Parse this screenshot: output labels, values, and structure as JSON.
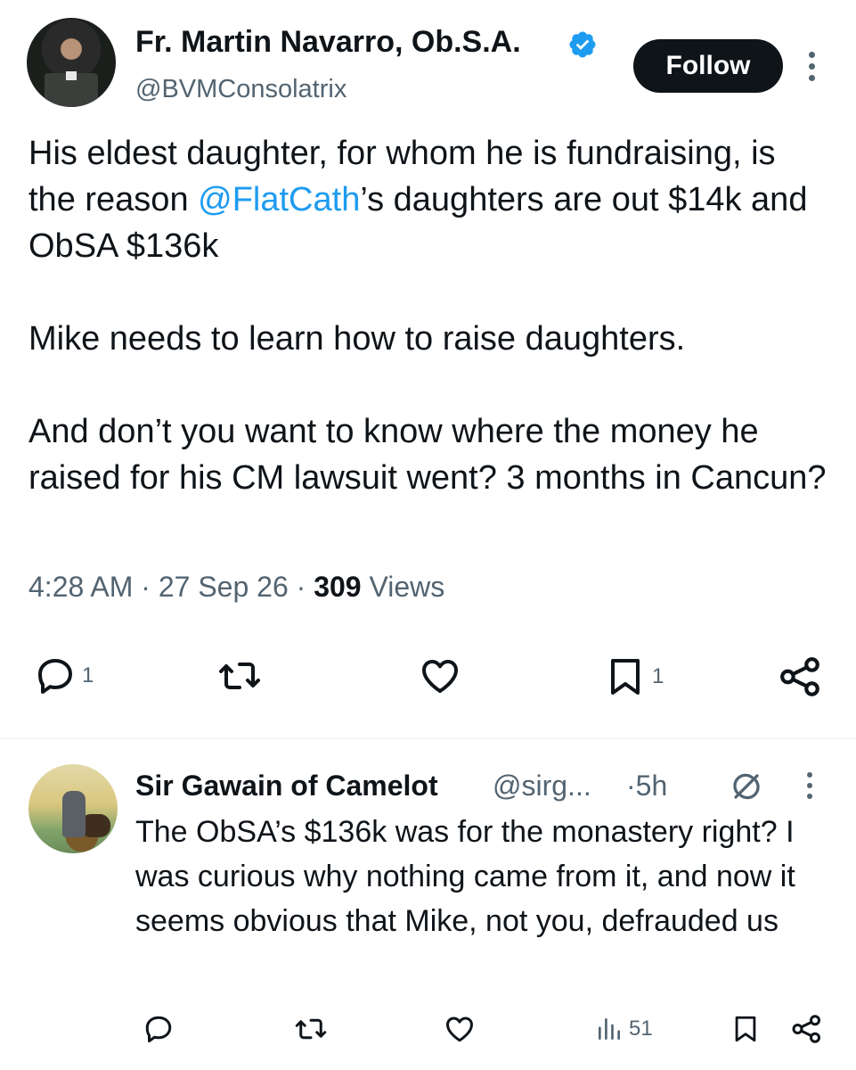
{
  "main_tweet": {
    "author_name": "Fr. Martin Navarro, Ob.S.A.",
    "handle": "@BVMConsolatrix",
    "follow_label": "Follow",
    "text_para1_before": "His eldest daughter, for whom he is fundraising, is the reason ",
    "text_para1_mention": "@FlatCath",
    "text_para1_after": "’s daughters are out $14k and ObSA $136k",
    "text_para2": "Mike needs to learn how to raise daughters.",
    "text_para3": "And don’t you want to know where the money he raised for his CM lawsuit went?  3 months in Cancun?",
    "time": "4:28 AM",
    "date": "27 Sep 26",
    "views_count": "309",
    "views_label": "Views",
    "reply_count": "1",
    "bookmark_count": "1"
  },
  "reply": {
    "author_name": "Sir Gawain of Camelot",
    "handle": "@sirg...",
    "time": "5h",
    "text": "The ObSA’s $136k was for the monastery right? I was curious why nothing came from it, and now it seems obvious that Mike, not you, defrauded us",
    "views_count": "51"
  },
  "colors": {
    "accent": "#1d9bf0",
    "secondary_text": "#536471",
    "primary_text": "#0f1419"
  },
  "icons": [
    "verified-badge-icon",
    "more-icon",
    "reply-icon",
    "retweet-icon",
    "like-icon",
    "bookmark-icon",
    "share-icon",
    "grok-icon",
    "views-icon"
  ]
}
